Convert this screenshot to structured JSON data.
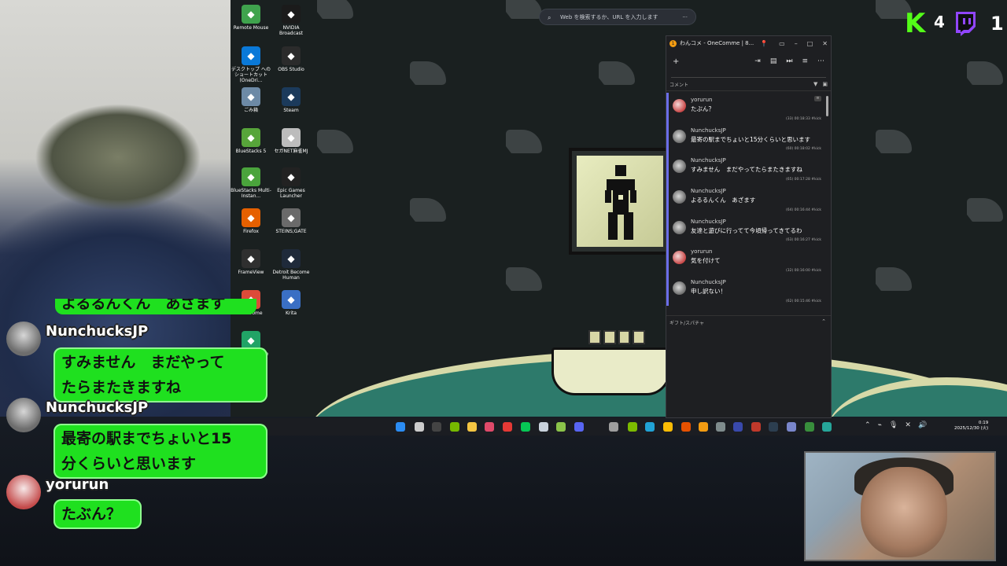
{
  "browser": {
    "search_placeholder": "Web を検索するか、URL を入力します",
    "more_label": "···"
  },
  "overlay_counts": {
    "kick_count": "4",
    "twitch_count": "1"
  },
  "desktop_icons": [
    {
      "label": "Remote Mouse",
      "icon": "remote-mouse-icon",
      "color": "#3fa34d"
    },
    {
      "label": "NVIDIA Broadcast",
      "icon": "nvidia-icon",
      "color": "#1b1b1b"
    },
    {
      "label": "デスクトップ へのショートカット (OneDri...",
      "icon": "onedrive-icon",
      "color": "#0a79d8"
    },
    {
      "label": "OBS Studio",
      "icon": "obs-icon",
      "color": "#2b2b2b"
    },
    {
      "label": "ごみ箱",
      "icon": "recycle-bin-icon",
      "color": "#6d8aa6"
    },
    {
      "label": "Steam",
      "icon": "steam-icon",
      "color": "#1b3a5b"
    },
    {
      "label": "BlueStacks 5",
      "icon": "bluestacks-icon",
      "color": "#57a53a"
    },
    {
      "label": "セガNET麻雀MJ",
      "icon": "mahjong-icon",
      "color": "#bcbcbc"
    },
    {
      "label": "BlueStacks Multi-Instan...",
      "icon": "bluestacks-multi-icon",
      "color": "#4aa43c"
    },
    {
      "label": "Epic Games Launcher",
      "icon": "epic-games-icon",
      "color": "#222222"
    },
    {
      "label": "Firefox",
      "icon": "firefox-icon",
      "color": "#e66000"
    },
    {
      "label": "STEINS;GATE",
      "icon": "steins-gate-icon",
      "color": "#6a6a6a"
    },
    {
      "label": "FrameView",
      "icon": "frameview-icon",
      "color": "#2f2f2f"
    },
    {
      "label": "Detroit Become Human",
      "icon": "detroit-icon",
      "color": "#1f2a3a"
    },
    {
      "label": "e Chrome",
      "icon": "chrome-icon",
      "color": "#dd4b39"
    },
    {
      "label": "Krita",
      "icon": "krita-icon",
      "color": "#3a6fc4"
    },
    {
      "label": "Microsoft Edge",
      "icon": "edge-icon",
      "color": "#21a366"
    }
  ],
  "onecomme": {
    "title": "わんコメ - OneComme | 8...",
    "add_label": "+",
    "section_label": "コメント",
    "gift_label": "ギフト/スパチャ",
    "comments": [
      {
        "name": "yorurun",
        "text": "たぶん？",
        "meta": "(33) 00:18:33 #kick",
        "avatar": "pink"
      },
      {
        "name": "NunchucksJP",
        "text": "最寄の駅までちょいと15分くらいと思います",
        "meta": "(60) 00:18:02 #kick",
        "avatar": "gray"
      },
      {
        "name": "NunchucksJP",
        "text": "すみません　まだやってたらまたきますね",
        "meta": "(65) 00:17:28 #kick",
        "avatar": "gray"
      },
      {
        "name": "NunchucksJP",
        "text": "よるるんくん　あざます",
        "meta": "(64) 00:16:44 #kick",
        "avatar": "gray"
      },
      {
        "name": "NunchucksJP",
        "text": "友達と遊びに行ってて今頃帰ってきてるわ",
        "meta": "(63) 00:16:27 #kick",
        "avatar": "gray"
      },
      {
        "name": "yorurun",
        "text": "気を付けて",
        "meta": "(32) 00:16:00 #kick",
        "avatar": "pink"
      },
      {
        "name": "NunchucksJP",
        "text": "申し訳ない！",
        "meta": "(62) 00:15:46 #kick",
        "avatar": "gray"
      }
    ]
  },
  "taskbar": {
    "time": "0:19",
    "date": "2025/12/30 (火)",
    "apps": [
      {
        "icon": "start-icon",
        "color": "#2b8cf3"
      },
      {
        "icon": "taskview-icon",
        "color": "#cccccc"
      },
      {
        "icon": "obs-taskbar-icon",
        "color": "#444444"
      },
      {
        "icon": "nvidia-taskbar-icon",
        "color": "#76b900"
      },
      {
        "icon": "folder-icon",
        "color": "#f4c542"
      },
      {
        "icon": "app-red-icon",
        "color": "#e04a6a"
      },
      {
        "icon": "record-icon",
        "color": "#e53935"
      },
      {
        "icon": "line-icon",
        "color": "#06c755"
      },
      {
        "icon": "steam-taskbar-icon",
        "color": "#c9d2dc"
      },
      {
        "icon": "notes-icon",
        "color": "#8bc34a"
      },
      {
        "icon": "discord-icon",
        "color": "#5865f2"
      },
      {
        "icon": "app-1-icon",
        "color": "#9e9e9e"
      },
      {
        "icon": "xbox-icon",
        "color": "#7cbb00"
      },
      {
        "icon": "edge-taskbar-icon",
        "color": "#21a3d6"
      },
      {
        "icon": "chrome-taskbar-icon",
        "color": "#fbbc05"
      },
      {
        "icon": "app-2-icon",
        "color": "#e65100"
      },
      {
        "icon": "onecomme-taskbar-icon",
        "color": "#f39c12"
      },
      {
        "icon": "app-3-icon",
        "color": "#7f8c8d"
      },
      {
        "icon": "app-4-icon",
        "color": "#3949ab"
      },
      {
        "icon": "app-5-icon",
        "color": "#c0392b"
      },
      {
        "icon": "app-6-icon",
        "color": "#2c3e50"
      },
      {
        "icon": "app-7-icon",
        "color": "#7986cb"
      },
      {
        "icon": "app-8-icon",
        "color": "#388e3c"
      },
      {
        "icon": "app-9-icon",
        "color": "#26a69a"
      }
    ]
  },
  "chat_overlay": {
    "partial_text": "よるるんくん　あざます",
    "messages": [
      {
        "name": "NunchucksJP",
        "lines": [
          "すみません　まだやって",
          "たらまたきますね"
        ],
        "avatar": "gray"
      },
      {
        "name": "NunchucksJP",
        "lines": [
          "最寄の駅までちょいと15",
          "分くらいと思います"
        ],
        "avatar": "gray"
      },
      {
        "name": "yorurun",
        "lines": [
          "たぶん？"
        ],
        "avatar": "pink"
      }
    ]
  },
  "colors": {
    "kick_green": "#53fc18",
    "twitch_purple": "#9146ff",
    "chat_bubble": "#1fe01f",
    "onecomme_accent": "#6a6ee8"
  }
}
